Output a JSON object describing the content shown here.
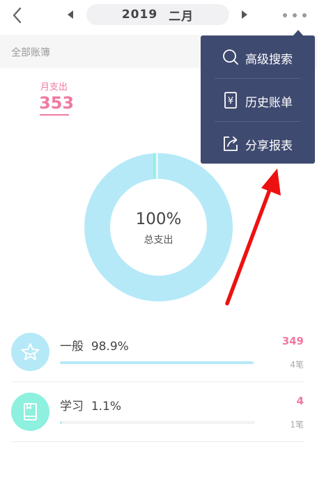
{
  "header": {
    "year": "2019",
    "month": "二月"
  },
  "book": {
    "label": "全部账簿"
  },
  "summary": {
    "month_label": "月支出",
    "month_value": "353"
  },
  "donut": {
    "percent_text": "100%",
    "sub_text": "总支出",
    "color": "#b5e9f8"
  },
  "categories": [
    {
      "name": "一般",
      "percent": "98.9%",
      "amount": "349",
      "count": "4笔",
      "fill": 0.989,
      "icon": "star-icon",
      "icon_color": "#b5e9f8"
    },
    {
      "name": "学习",
      "percent": "1.1%",
      "amount": "4",
      "count": "1笔",
      "fill": 0.011,
      "icon": "book-icon",
      "icon_color": "#8ef0de"
    }
  ],
  "menu": {
    "items": [
      {
        "label": "高级搜索",
        "icon": "search-icon"
      },
      {
        "label": "历史账单",
        "icon": "bill-icon"
      },
      {
        "label": "分享报表",
        "icon": "share-icon"
      }
    ]
  },
  "colors": {
    "accent_pink": "#f07aa0",
    "menu_bg": "#3f4a70",
    "annotation_red": "#ee1111"
  }
}
